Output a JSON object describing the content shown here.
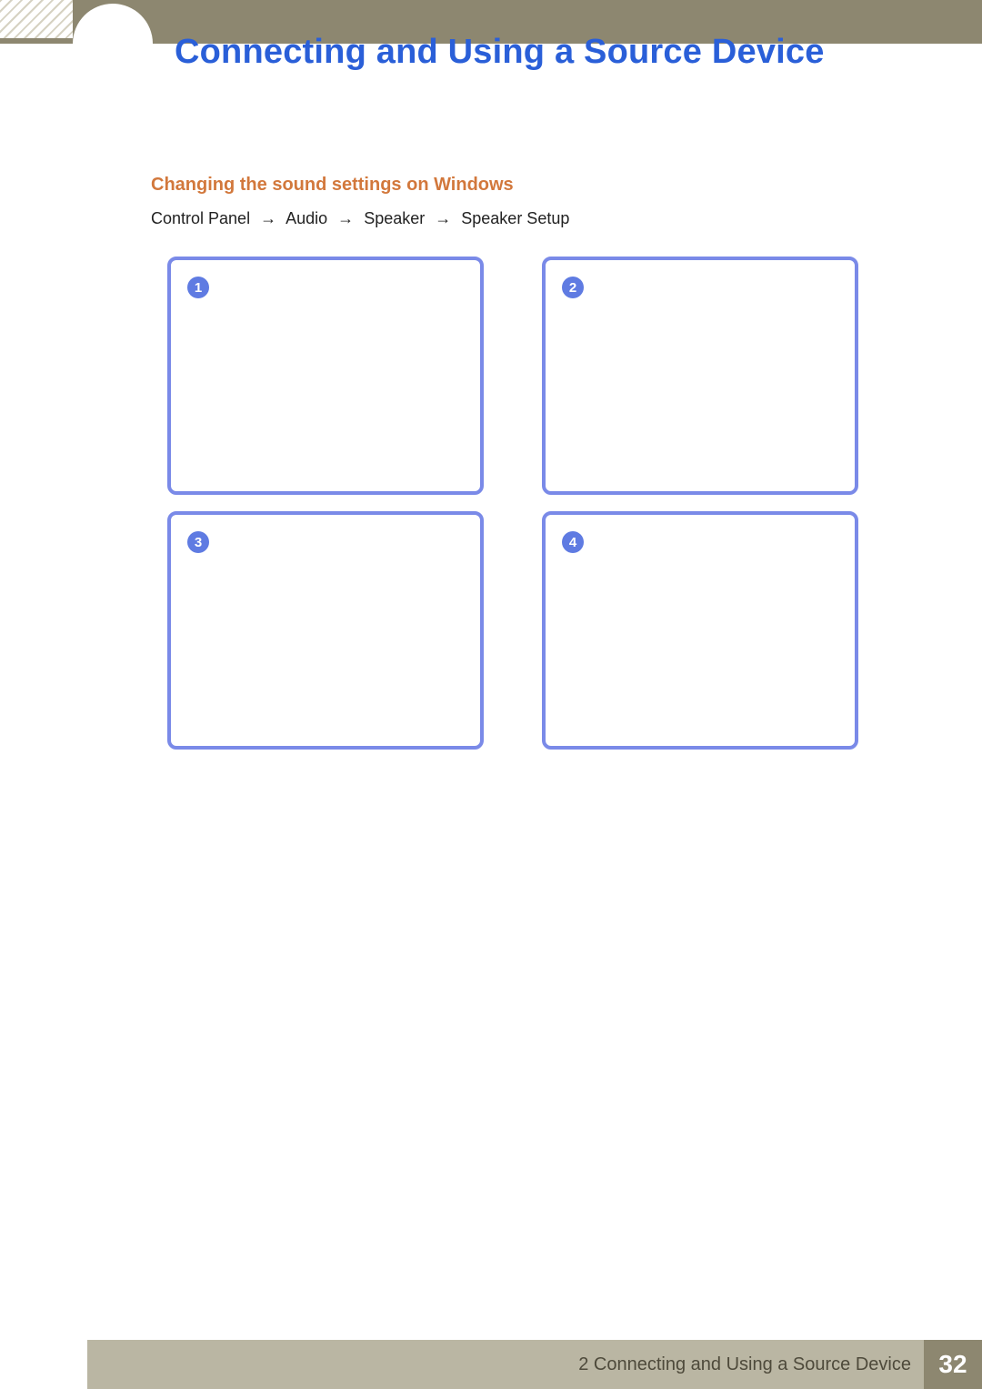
{
  "header": {
    "chapter_title": "Connecting and Using a Source Device"
  },
  "section": {
    "heading": "Changing the sound settings on Windows",
    "breadcrumb": [
      "Control Panel",
      "Audio",
      "Speaker",
      "Speaker Setup"
    ],
    "arrow": "→"
  },
  "steps": {
    "items": [
      {
        "num": "1"
      },
      {
        "num": "2"
      },
      {
        "num": "3"
      },
      {
        "num": "4"
      }
    ]
  },
  "footer": {
    "chapter_ref": "2 Connecting and Using a Source Device",
    "page_number": "32"
  }
}
